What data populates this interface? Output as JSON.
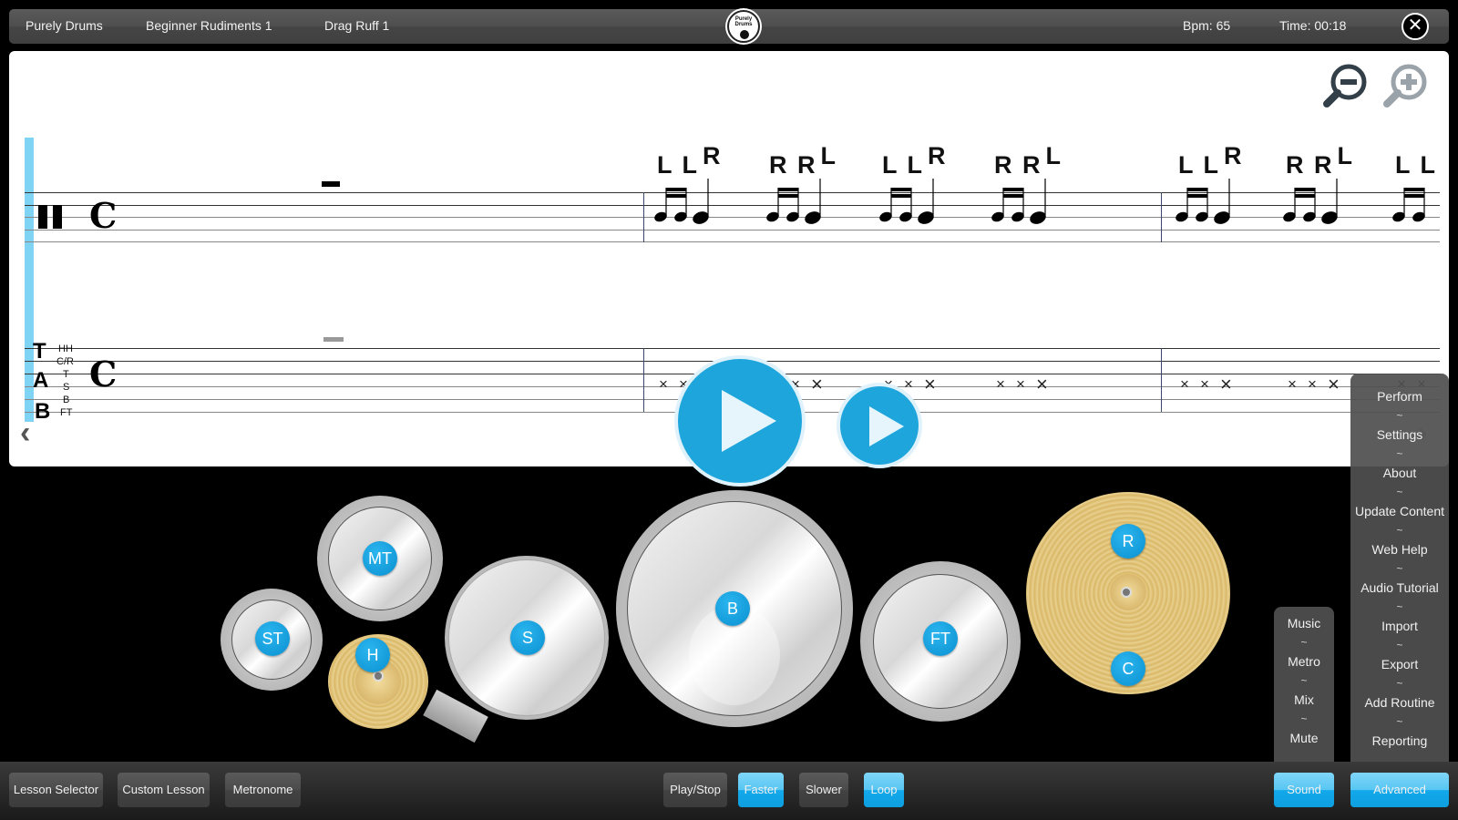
{
  "header": {
    "app_name": "Purely Drums",
    "lesson_group": "Beginner Rudiments 1",
    "lesson_name": "Drag Ruff 1",
    "logo_text": "Purely Drums",
    "bpm": "Bpm: 65",
    "time": "Time: 00:18",
    "close_icon": "close-icon"
  },
  "score": {
    "zoom_out_icon": "zoom-out-icon",
    "zoom_in_icon": "zoom-in-icon",
    "percussion_clef": "𝄥",
    "time_signature": "C",
    "tab_letters": [
      "T",
      "A",
      "B"
    ],
    "tab_instruments": [
      "HH",
      "C/R",
      "T",
      "S",
      "B",
      "FT"
    ],
    "stickings": [
      {
        "pair": "L L",
        "accent": "R"
      },
      {
        "pair": "R R",
        "accent": "L"
      },
      {
        "pair": "L L",
        "accent": "R"
      },
      {
        "pair": "R R",
        "accent": "L"
      },
      {
        "pair": "L L",
        "accent": "R"
      },
      {
        "pair": "R R",
        "accent": "L"
      },
      {
        "pair": "L L",
        "accent": ""
      }
    ],
    "tab_hit_symbol": "×",
    "prev_arrow": "‹",
    "next_arrow": "›"
  },
  "playback": {
    "big_play_icon": "play-icon",
    "small_play_icon": "play-icon"
  },
  "kit": {
    "pads": [
      "ST",
      "MT",
      "H",
      "S",
      "B",
      "FT",
      "R",
      "C"
    ]
  },
  "advanced_menu": {
    "items": [
      "Perform",
      "Settings",
      "About",
      "Update Content",
      "Web Help",
      "Audio Tutorial",
      "Import",
      "Export",
      "Add Routine",
      "Reporting"
    ],
    "separator": "~"
  },
  "sound_menu": {
    "items": [
      "Music",
      "Metro",
      "Mix",
      "Mute"
    ],
    "separator": "~"
  },
  "bottom_bar": {
    "lesson_selector": "Lesson Selector",
    "custom_lesson": "Custom Lesson",
    "metronome": "Metronome",
    "play_stop": "Play/Stop",
    "faster": "Faster",
    "slower": "Slower",
    "loop": "Loop",
    "sound": "Sound",
    "advanced": "Advanced"
  },
  "colors": {
    "accent_blue": "#12a9ea",
    "cursor_blue": "#7fd4f6",
    "play_blue": "#1ea6dc",
    "cymbal_gold": "#e2c57c"
  }
}
